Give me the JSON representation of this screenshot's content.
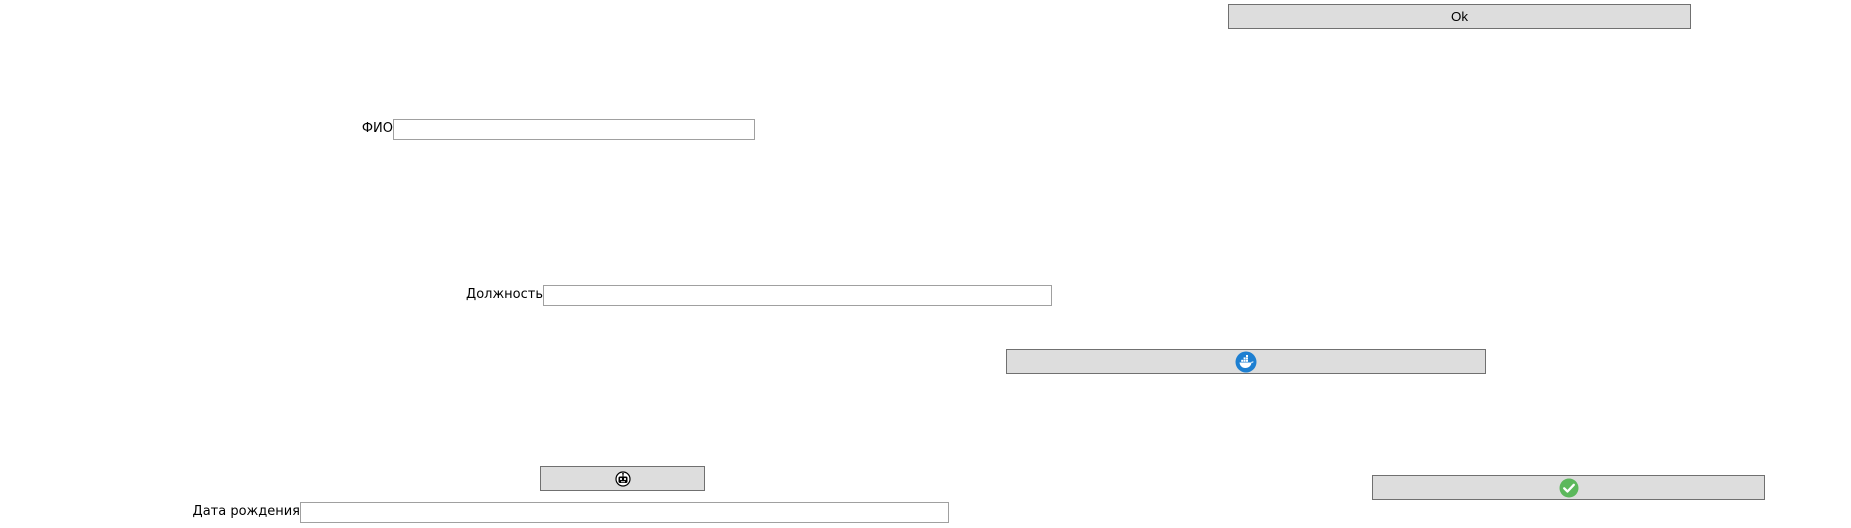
{
  "buttons": {
    "ok": {
      "label": "Ok"
    },
    "docker": {
      "icon": "docker-whale-icon",
      "color": "#1d7fd1"
    },
    "robot": {
      "icon": "robot-face-icon"
    },
    "confirm": {
      "icon": "check-circle-icon",
      "color": "#5cb85c"
    }
  },
  "fields": {
    "fio": {
      "label": "ФИО",
      "value": "",
      "placeholder": ""
    },
    "position": {
      "label": "Должность",
      "value": "",
      "placeholder": ""
    },
    "birth_date": {
      "label": "Дата рождения",
      "value": "",
      "placeholder": ""
    }
  }
}
